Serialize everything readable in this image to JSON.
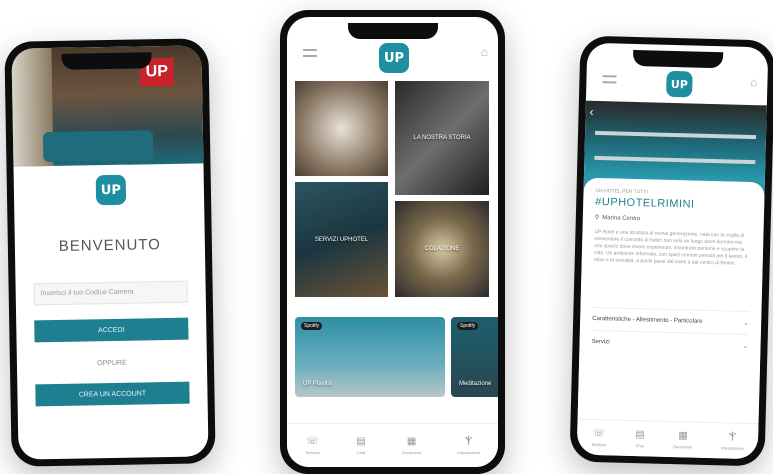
{
  "phone_login": {
    "logo": "UP",
    "lobby_sign": "UP",
    "welcome": "BENVENUTO",
    "code_placeholder": "Inserisci il tuo Codice Camera",
    "login_button": "ACCEDI",
    "or_text": "OPPURE",
    "register_button": "CREA UN ACCOUNT"
  },
  "phone_home": {
    "logo": "UP",
    "tiles": [
      {
        "label": ""
      },
      {
        "label": "LA NOSTRA STORIA"
      },
      {
        "label": "SERVIZI UPHOTEL"
      },
      {
        "label": "COLAZIONE"
      },
      {
        "label": "UP Playlist",
        "badge": "Spotify"
      },
      {
        "label": "Meditazione",
        "badge": "Spotify"
      }
    ],
    "nav": [
      {
        "icon": "☏",
        "label": "Telefono"
      },
      {
        "icon": "▤",
        "label": "Chat"
      },
      {
        "icon": "▦",
        "label": "Documenti"
      },
      {
        "icon": "Ⲯ",
        "label": "Impostazioni"
      }
    ]
  },
  "phone_detail": {
    "logo": "UP",
    "kicker": "UN HOTEL PER TUTTI",
    "title": "#UPHOTELRIMINI",
    "location": "Marina Centro",
    "description": "UP Hotel è una struttura di nuova generazione, nata con la voglia di reinventare il concetto di hotel: non solo un luogo dove dormire ma uno spazio dove vivere esperienze, incontrare persone e scoprire la città. Un ambiente informale, con spazi comuni pensati per il lavoro, il relax e la socialità, a pochi passi dal mare e dal centro di Rimini.",
    "sections": [
      {
        "label": "Caratteristiche - Allestimento - Particolare"
      },
      {
        "label": "Servizi"
      }
    ],
    "nav": [
      {
        "icon": "☏",
        "label": "Telefono"
      },
      {
        "icon": "▤",
        "label": "Chat"
      },
      {
        "icon": "▦",
        "label": "Documenti"
      },
      {
        "icon": "Ⲯ",
        "label": "Impostazioni"
      }
    ]
  },
  "colors": {
    "accent": "#1e7f90",
    "logo_bg": "#1e8fa0",
    "frame": "#0d0d0d"
  }
}
